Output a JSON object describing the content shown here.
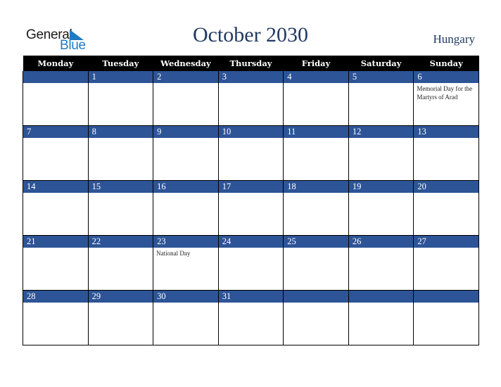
{
  "logo": {
    "line1": "General",
    "line2": "Blue"
  },
  "header": {
    "title": "October 2030",
    "country": "Hungary"
  },
  "weekdays": [
    "Monday",
    "Tuesday",
    "Wednesday",
    "Thursday",
    "Friday",
    "Saturday",
    "Sunday"
  ],
  "weeks": [
    [
      {
        "day": "",
        "event": ""
      },
      {
        "day": "1",
        "event": ""
      },
      {
        "day": "2",
        "event": ""
      },
      {
        "day": "3",
        "event": ""
      },
      {
        "day": "4",
        "event": ""
      },
      {
        "day": "5",
        "event": ""
      },
      {
        "day": "6",
        "event": "Memorial Day for the Martyrs of Arad"
      }
    ],
    [
      {
        "day": "7",
        "event": ""
      },
      {
        "day": "8",
        "event": ""
      },
      {
        "day": "9",
        "event": ""
      },
      {
        "day": "10",
        "event": ""
      },
      {
        "day": "11",
        "event": ""
      },
      {
        "day": "12",
        "event": ""
      },
      {
        "day": "13",
        "event": ""
      }
    ],
    [
      {
        "day": "14",
        "event": ""
      },
      {
        "day": "15",
        "event": ""
      },
      {
        "day": "16",
        "event": ""
      },
      {
        "day": "17",
        "event": ""
      },
      {
        "day": "18",
        "event": ""
      },
      {
        "day": "19",
        "event": ""
      },
      {
        "day": "20",
        "event": ""
      }
    ],
    [
      {
        "day": "21",
        "event": ""
      },
      {
        "day": "22",
        "event": ""
      },
      {
        "day": "23",
        "event": "National Day"
      },
      {
        "day": "24",
        "event": ""
      },
      {
        "day": "25",
        "event": ""
      },
      {
        "day": "26",
        "event": ""
      },
      {
        "day": "27",
        "event": ""
      }
    ],
    [
      {
        "day": "28",
        "event": ""
      },
      {
        "day": "29",
        "event": ""
      },
      {
        "day": "30",
        "event": ""
      },
      {
        "day": "31",
        "event": ""
      },
      {
        "day": "",
        "event": ""
      },
      {
        "day": "",
        "event": ""
      },
      {
        "day": "",
        "event": ""
      }
    ]
  ],
  "colors": {
    "band": "#2d5496",
    "header_bg": "#000000",
    "title": "#203a63",
    "logo_blue": "#1f7bc2"
  }
}
